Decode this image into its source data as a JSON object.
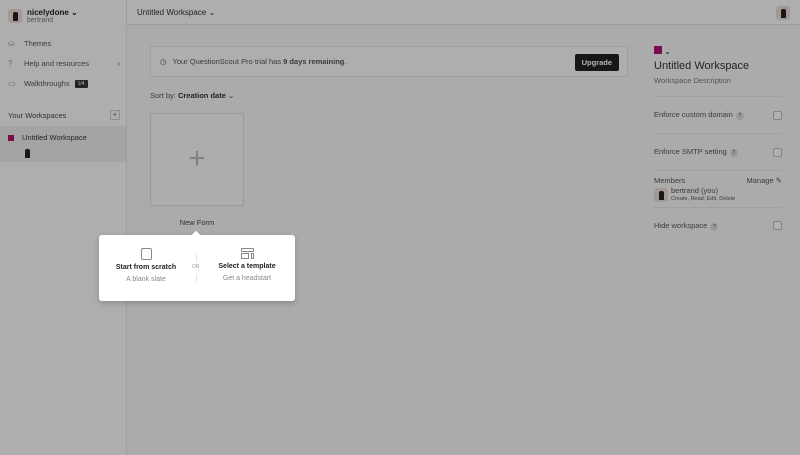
{
  "user": {
    "name": "nicelydone",
    "sub": "bertrand"
  },
  "nav": [
    {
      "label": "Themes"
    },
    {
      "label": "Help and resources"
    },
    {
      "label": "Walkthroughs",
      "badge": "1/4"
    }
  ],
  "workspaces": {
    "heading": "Your Workspaces",
    "items": [
      {
        "label": "Untitled Workspace",
        "color": "#b0136e"
      }
    ]
  },
  "topbar": {
    "title": "Untitled Workspace"
  },
  "banner": {
    "text_before": "Your QuestionScout Pro trial has ",
    "highlight": "9 days remaining",
    "text_after": ".",
    "button": "Upgrade"
  },
  "sort": {
    "label": "Sort by:",
    "value": "Creation date"
  },
  "new_form": {
    "label": "New Form"
  },
  "popup": {
    "scratch_title": "Start from scratch",
    "scratch_sub": "A blank slate",
    "or": "OR",
    "template_title": "Select a template",
    "template_sub": "Get a headstart"
  },
  "panel": {
    "title": "Untitled Workspace",
    "description": "Workspace Description",
    "custom_domain": "Enforce custom domain",
    "smtp": "Enforce SMTP setting",
    "members": "Members",
    "manage": "Manage",
    "member_name": "bertrand (you)",
    "member_perms": "Create, Read, Edit, Delete",
    "hide": "Hide workspace",
    "help": "?"
  }
}
